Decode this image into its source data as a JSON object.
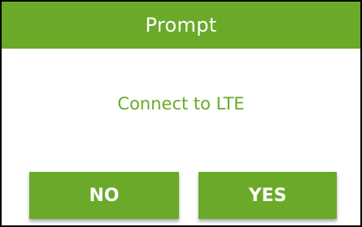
{
  "dialog": {
    "title": "Prompt",
    "message": "Connect to LTE",
    "buttons": {
      "no_label": "NO",
      "yes_label": "YES"
    }
  },
  "colors": {
    "accent": "#6aaa28",
    "border": "#000000",
    "background": "#ffffff",
    "button_text": "#ffffff"
  }
}
